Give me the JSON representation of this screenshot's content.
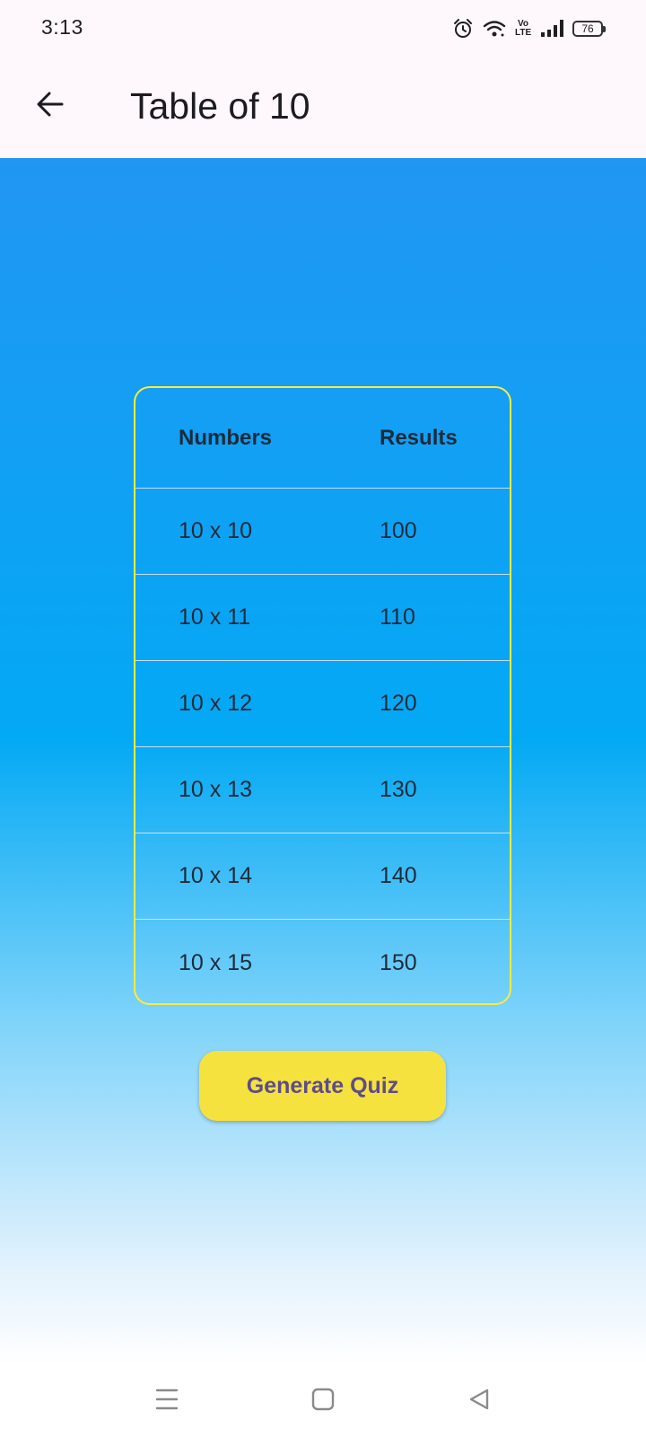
{
  "status_bar": {
    "time": "3:13",
    "volte": "Vo LTE",
    "battery": "76",
    "icons": [
      "alarm-icon",
      "wifi-icon",
      "signal-icon",
      "battery-icon"
    ]
  },
  "app_bar": {
    "title": "Table of 10",
    "back_icon": "arrow-back-icon"
  },
  "table": {
    "headers": [
      "Numbers",
      "Results"
    ],
    "rows": [
      [
        "10 x 10",
        "100"
      ],
      [
        "10 x 11",
        "110"
      ],
      [
        "10 x 12",
        "120"
      ],
      [
        "10 x 13",
        "130"
      ],
      [
        "10 x 14",
        "140"
      ],
      [
        "10 x 15",
        "150"
      ]
    ],
    "border_color": "#ffeb3b"
  },
  "actions": {
    "generate_label": "Generate Quiz",
    "button_color": "#f5e23f",
    "text_color": "#5f4b8b"
  },
  "nav_bar": {
    "icons": [
      "menu-icon",
      "home-icon",
      "back-triangle-icon"
    ]
  },
  "colors": {
    "gradient_top": "#2196f3",
    "gradient_mid": "#03a9f4",
    "gradient_bottom": "#ffffff"
  }
}
